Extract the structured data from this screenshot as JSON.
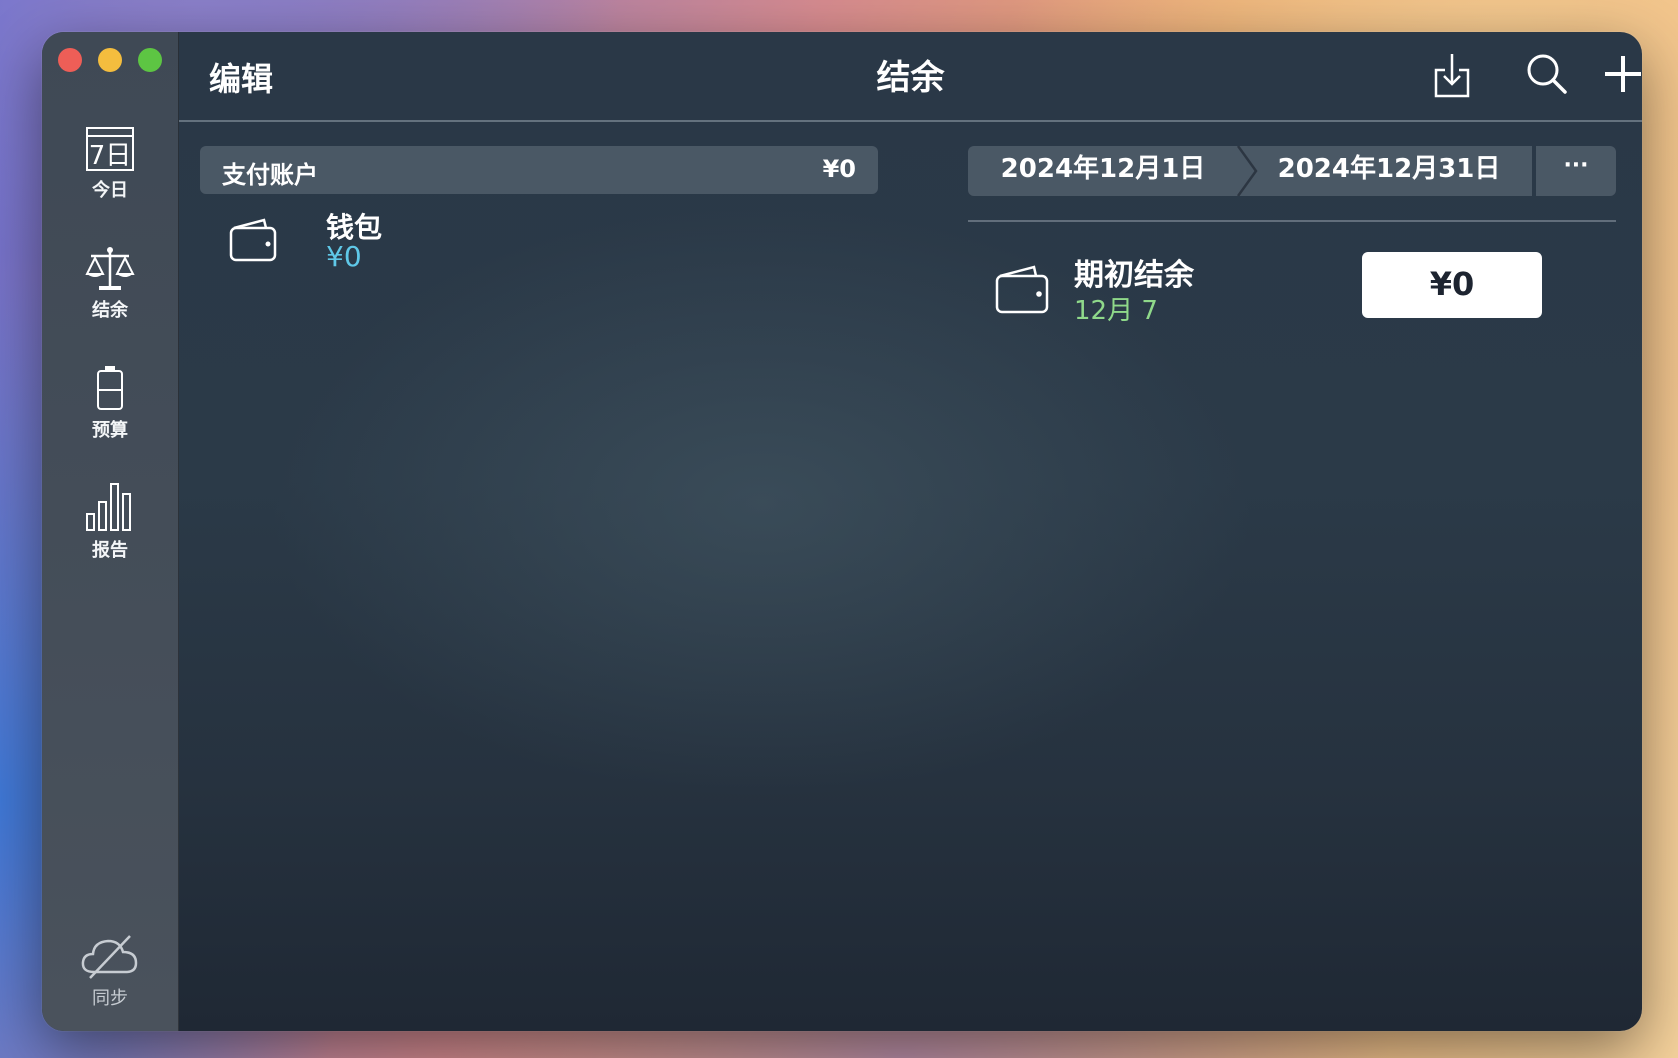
{
  "sidebar": {
    "items": [
      {
        "label": "今日",
        "icon": "calendar-icon",
        "icon_text": "7日"
      },
      {
        "label": "结余",
        "icon": "scale-icon"
      },
      {
        "label": "预算",
        "icon": "battery-icon"
      },
      {
        "label": "报告",
        "icon": "bar-chart-icon"
      }
    ],
    "sync_label": "同步"
  },
  "toolbar": {
    "edit_label": "编辑",
    "title": "结余"
  },
  "accounts": {
    "header_name": "支付账户",
    "header_amount": "¥0",
    "wallet_name": "钱包",
    "wallet_amount": "¥0"
  },
  "period": {
    "start": "2024年12月1日",
    "end": "2024年12月31日",
    "more_label": "···"
  },
  "opening_balance": {
    "name": "期初结余",
    "date": "12月 7",
    "amount": "¥0"
  },
  "colors": {
    "accent_blue": "#5fc8e8",
    "accent_green": "#8fd98a"
  }
}
